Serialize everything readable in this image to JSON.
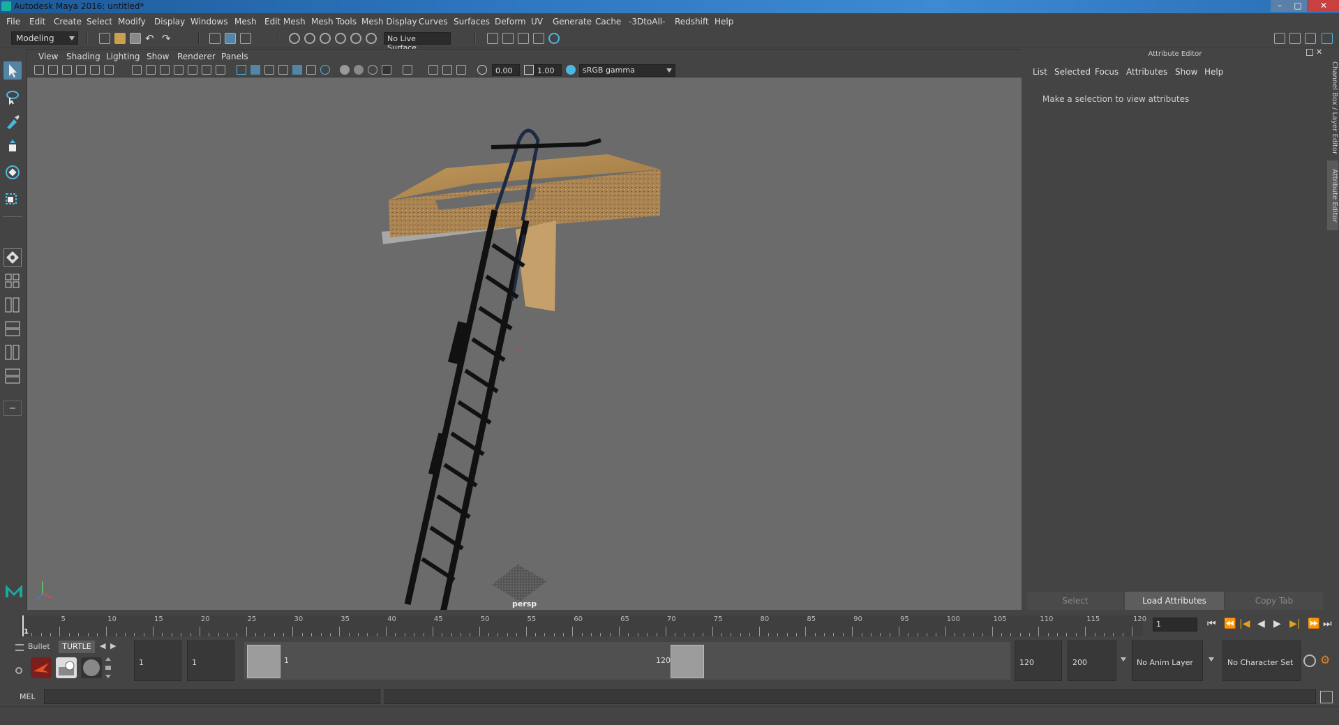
{
  "window": {
    "title": "Autodesk Maya 2016: untitled*"
  },
  "menubar": [
    "File",
    "Edit",
    "Create",
    "Select",
    "Modify",
    "Display",
    "Windows",
    "Mesh",
    "Edit Mesh",
    "Mesh Tools",
    "Mesh Display",
    "Curves",
    "Surfaces",
    "Deform",
    "UV",
    "Generate",
    "Cache",
    "-3DtoAll-",
    "Redshift",
    "Help"
  ],
  "statusline": {
    "menu_set": "Modeling",
    "live_surface": "No Live Surface"
  },
  "viewport": {
    "menus": [
      "View",
      "Shading",
      "Lighting",
      "Show",
      "Renderer",
      "Panels"
    ],
    "exposure": "0.00",
    "gamma": "1.00",
    "color_space": "sRGB gamma",
    "camera_label": "persp"
  },
  "attribute_editor": {
    "title": "Attribute Editor",
    "menus": [
      "List",
      "Selected",
      "Focus",
      "Attributes",
      "Show",
      "Help"
    ],
    "message": "Make a selection to view attributes",
    "buttons": {
      "select": "Select",
      "load": "Load Attributes",
      "copy": "Copy Tab"
    }
  },
  "side_tabs": {
    "channel_box": "Channel Box / Layer Editor",
    "attribute_editor": "Attribute Editor"
  },
  "timeline": {
    "ticks": [
      "1",
      "5",
      "10",
      "15",
      "20",
      "25",
      "30",
      "35",
      "40",
      "45",
      "50",
      "55",
      "60",
      "65",
      "70",
      "75",
      "80",
      "85",
      "90",
      "95",
      "100",
      "105",
      "110",
      "115",
      "120"
    ],
    "current_frame": "1"
  },
  "shelf_tabs": {
    "bullet": "Bullet",
    "turtle": "TURTLE"
  },
  "range": {
    "start": "1",
    "playback_start": "1",
    "range_start_label": "1",
    "range_end_label": "120",
    "playback_end": "120",
    "end": "200",
    "anim_layer": "No Anim Layer",
    "character_set": "No Character Set"
  },
  "cmdline": {
    "label": "MEL"
  }
}
